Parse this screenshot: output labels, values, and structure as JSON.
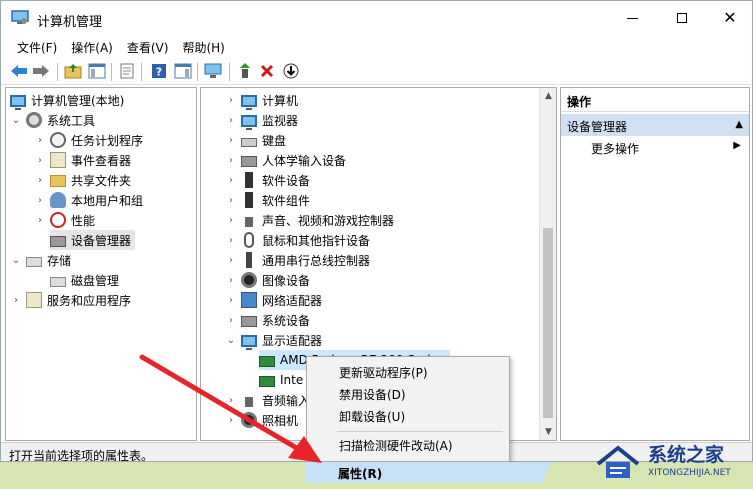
{
  "window": {
    "title": "计算机管理",
    "menu": [
      "文件(F)",
      "操作(A)",
      "查看(V)",
      "帮助(H)"
    ]
  },
  "tree": {
    "root": "计算机管理(本地)",
    "items": [
      {
        "label": "系统工具",
        "icon": "tools-icon",
        "expanded": true
      },
      {
        "label": "任务计划程序",
        "icon": "clock-icon"
      },
      {
        "label": "事件查看器",
        "icon": "event-log-icon"
      },
      {
        "label": "共享文件夹",
        "icon": "folder-icon"
      },
      {
        "label": "本地用户和组",
        "icon": "users-icon"
      },
      {
        "label": "性能",
        "icon": "performance-icon"
      },
      {
        "label": "设备管理器",
        "icon": "device-manager-icon",
        "selected": true
      },
      {
        "label": "存储",
        "icon": "storage-icon",
        "expanded": true
      },
      {
        "label": "磁盘管理",
        "icon": "disk-icon"
      },
      {
        "label": "服务和应用程序",
        "icon": "services-icon"
      }
    ]
  },
  "devices": [
    {
      "label": "计算机",
      "icon": "computer-icon"
    },
    {
      "label": "监视器",
      "icon": "monitor-icon"
    },
    {
      "label": "键盘",
      "icon": "keyboard-icon"
    },
    {
      "label": "人体学输入设备",
      "icon": "hid-icon"
    },
    {
      "label": "软件设备",
      "icon": "software-device-icon"
    },
    {
      "label": "软件组件",
      "icon": "software-component-icon"
    },
    {
      "label": "声音、视频和游戏控制器",
      "icon": "speaker-icon"
    },
    {
      "label": "鼠标和其他指针设备",
      "icon": "mouse-icon"
    },
    {
      "label": "通用串行总线控制器",
      "icon": "usb-icon"
    },
    {
      "label": "图像设备",
      "icon": "image-device-icon"
    },
    {
      "label": "网络适配器",
      "icon": "network-icon"
    },
    {
      "label": "系统设备",
      "icon": "system-device-icon"
    },
    {
      "label": "显示适配器",
      "icon": "display-adapter-icon",
      "expanded": true
    },
    {
      "label": "AMD Radeon R7 200 Series",
      "icon": "graphics-card-icon",
      "child": true,
      "selected": true
    },
    {
      "label": "Inte",
      "icon": "graphics-card-icon",
      "child": true
    },
    {
      "label": "音频输入",
      "icon": "audio-input-icon"
    },
    {
      "label": "照相机",
      "icon": "camera-icon"
    }
  ],
  "actions": {
    "header": "操作",
    "section": "设备管理器",
    "more": "更多操作"
  },
  "status": "打开当前选择项的属性表。",
  "context_menu": {
    "items": [
      "更新驱动程序(P)",
      "禁用设备(D)",
      "卸载设备(U)",
      "扫描检测硬件改动(A)"
    ],
    "highlighted": "属性(R)"
  },
  "watermark": {
    "title": "系统之家",
    "subtitle": "XITONGZHIJIA.NET"
  },
  "colors": {
    "arrow": "#e8232a",
    "selection": "#cce8ff",
    "action_section": "#cfe0f2"
  }
}
